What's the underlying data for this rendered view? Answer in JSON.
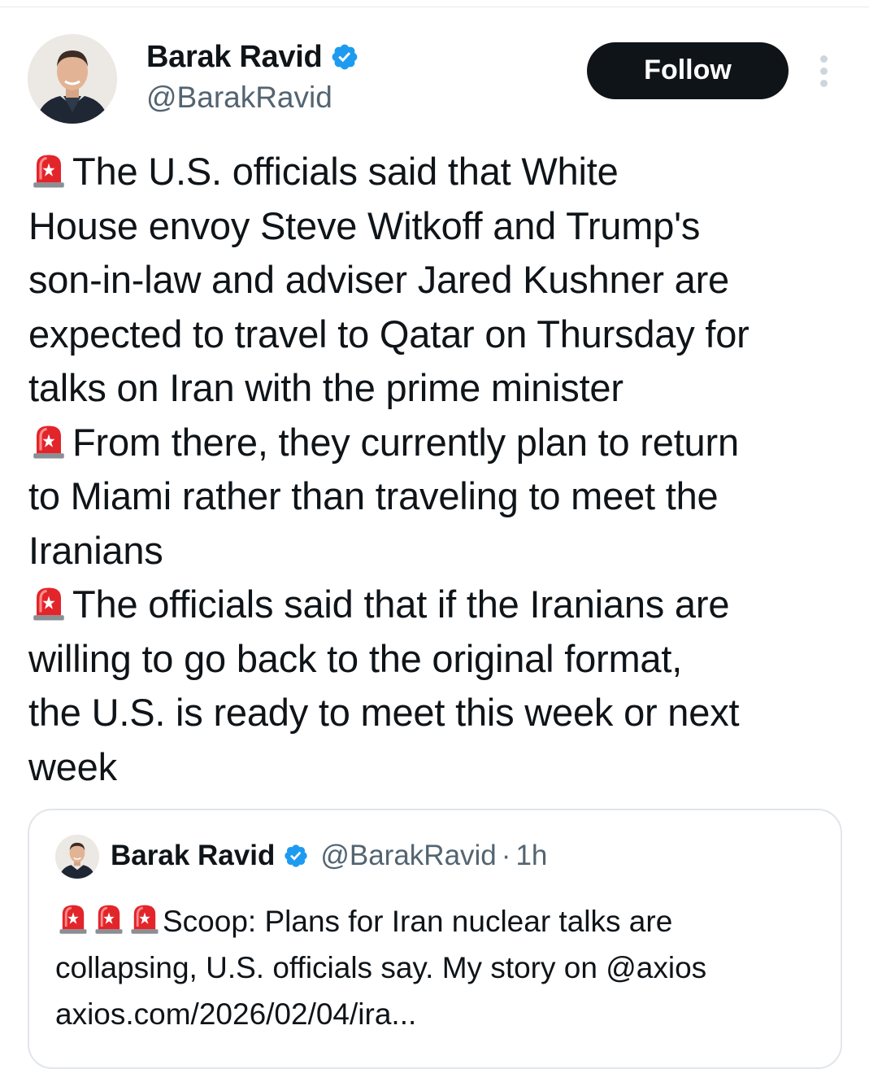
{
  "author": {
    "display_name": "Barak Ravid",
    "handle": "@BarakRavid",
    "verified_icon": "verified-badge-icon",
    "avatar_icon": "profile-photo"
  },
  "actions": {
    "follow_label": "Follow",
    "more_icon": "more-vertical-icon"
  },
  "tweet": {
    "emoji": "🚨",
    "lines": [
      "The U.S. officials said that White",
      "House envoy Steve Witkoff and Trump's",
      "son-in-law and adviser Jared Kushner are",
      "expected to travel to Qatar on Thursday for",
      "talks on Iran with the prime minister",
      "From there, they currently plan to return",
      "to Miami rather than traveling to meet the",
      "Iranians",
      "The officials said that if the Iranians are",
      "willing to go back to the original format,",
      "the U.S. is ready to meet this week or next",
      "week"
    ]
  },
  "quoted": {
    "display_name": "Barak Ravid",
    "handle": "@BarakRavid",
    "separator": "·",
    "time": "1h",
    "lines": [
      "Scoop: Plans for Iran nuclear talks are",
      "collapsing, U.S. officials say. My story on @axios",
      "axios.com/2026/02/04/ira..."
    ]
  },
  "colors": {
    "text": "#0f1419",
    "secondary": "#536471",
    "verified": "#1d9bf0",
    "button": "#0f1419",
    "border": "#e1e6ea"
  }
}
